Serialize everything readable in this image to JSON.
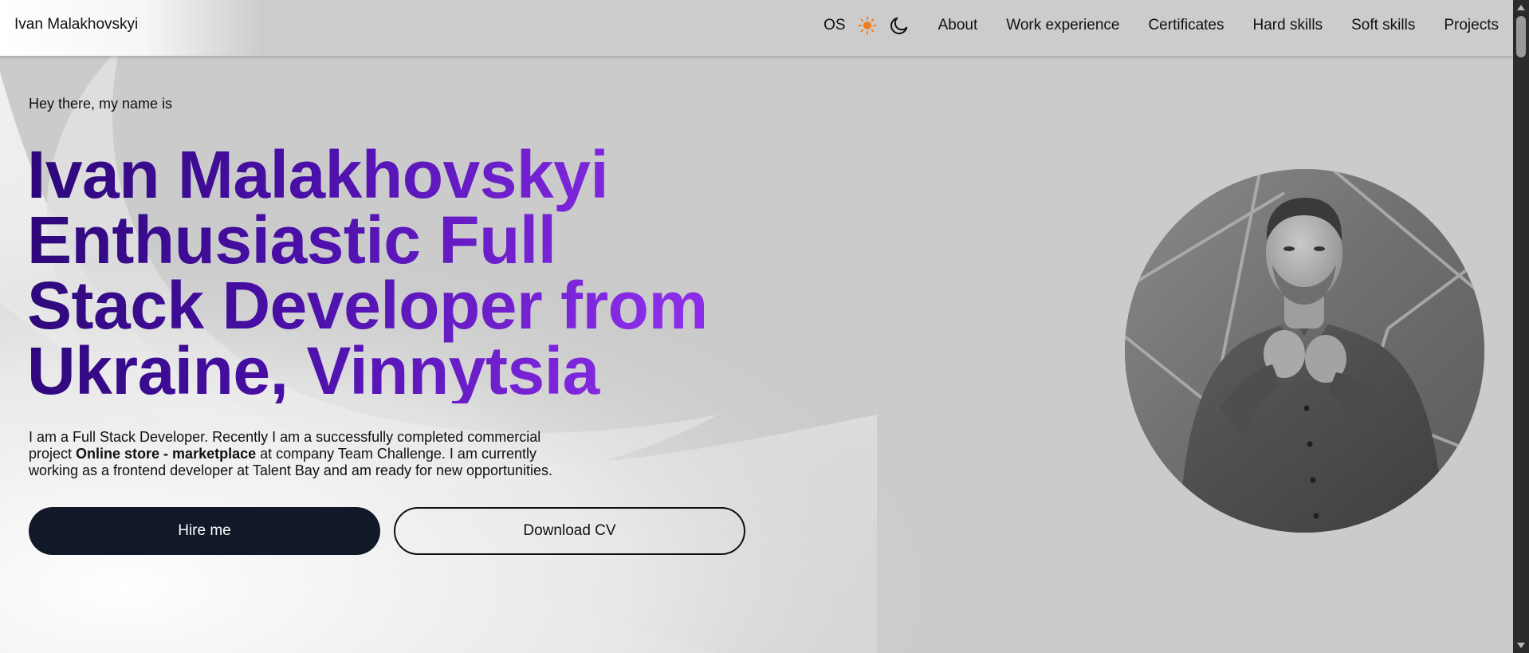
{
  "header": {
    "brand": "Ivan Malakhovskyi",
    "theme": {
      "os_label": "OS",
      "sun_icon": "sun-icon",
      "moon_icon": "moon-icon",
      "sun_color": "#f07d1a"
    },
    "nav": [
      {
        "label": "About"
      },
      {
        "label": "Work experience"
      },
      {
        "label": "Certificates"
      },
      {
        "label": "Hard skills"
      },
      {
        "label": "Soft skills"
      },
      {
        "label": "Projects"
      }
    ]
  },
  "hero": {
    "greeting": "Hey there, my name is",
    "headline_lines": [
      "Ivan Malakhovskyi",
      "Enthusiastic Full",
      "Stack Developer from",
      "Ukraine, Vinnytsia"
    ],
    "intro": {
      "part1": "I am a Full Stack Developer. Recently I am a successfully completed commercial project ",
      "bold": "Online store - marketplace",
      "part2": " at company Team Challenge. I am currently working as a frontend developer at Talent Bay and am ready for new opportunities."
    },
    "buttons": {
      "hire": "Hire me",
      "cv": "Download CV"
    }
  },
  "colors": {
    "headline_start": "#2c0878",
    "headline_end": "#8a2ce8",
    "primary_button": "#111827",
    "page_background": "#cbcbcb"
  }
}
